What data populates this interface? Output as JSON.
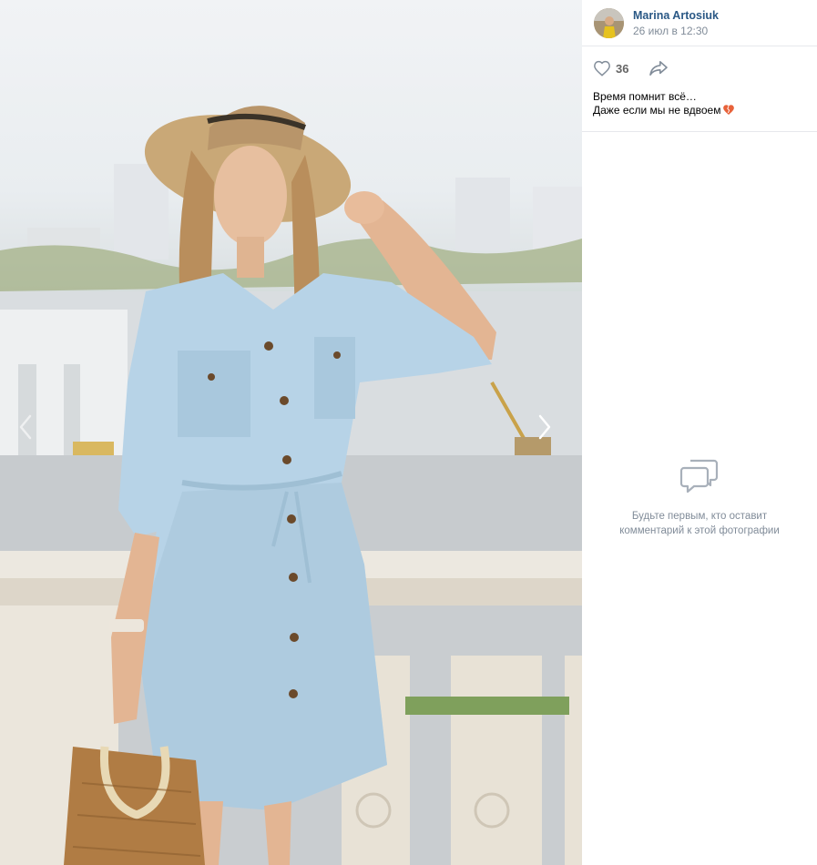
{
  "photo": {
    "alt": "",
    "nav_prev_icon": "chevron-left-icon",
    "nav_next_icon": "chevron-right-icon"
  },
  "post": {
    "author_name": "Marina Artosiuk",
    "date": "26 июл в 12:30",
    "likes_count": "36",
    "caption_line1": "Время помнит всё…",
    "caption_line2": "Даже если мы не вдвоем",
    "caption_emoji_icon": "broken-heart-icon"
  },
  "comments": {
    "empty_line1": "Будьте первым, кто оставит",
    "empty_line2": "комментарий к этой фотографии"
  },
  "colors": {
    "link": "#2a5885",
    "muted": "#818c99",
    "divider": "#e7e8ec",
    "heart_emoji": "#e8623a"
  }
}
